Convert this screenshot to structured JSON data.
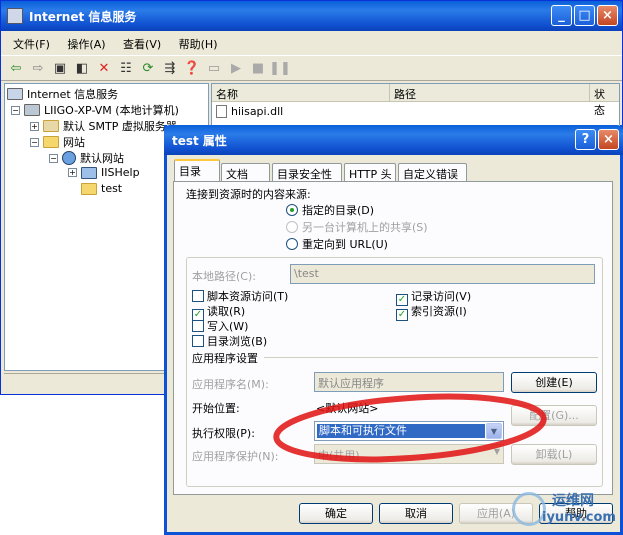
{
  "main_window": {
    "title": "Internet 信息服务",
    "controls": [
      "_",
      "□",
      "×"
    ]
  },
  "menu": [
    "文件(F)",
    "操作(A)",
    "查看(V)",
    "帮助(H)"
  ],
  "tree": {
    "root": "Internet 信息服务",
    "computer": "LIIGO-XP-VM (本地计算机)",
    "smtp": "默认 SMTP 虚拟服务器",
    "websites": "网站",
    "default_site": "默认网站",
    "iishelp": "IISHelp",
    "test": "test"
  },
  "list": {
    "columns": [
      "名称",
      "路径",
      "状态"
    ],
    "rows": [
      "hiisapi.dll"
    ]
  },
  "dialog": {
    "title": "test 属性",
    "help": "?",
    "close": "×",
    "tabs": [
      "目录",
      "文档",
      "目录安全性",
      "HTTP 头",
      "自定义错误"
    ],
    "content_source_label": "连接到资源时的内容来源:",
    "radio_dir": "指定的目录(D)",
    "radio_share": "另一台计算机上的共享(S)",
    "radio_url": "重定向到 URL(U)",
    "local_path_label": "本地路径(C):",
    "local_path_value": "\\test",
    "chk_script": "脚本资源访问(T)",
    "chk_log": "记录访问(V)",
    "chk_read": "读取(R)",
    "chk_index": "索引资源(I)",
    "chk_write": "写入(W)",
    "chk_browse": "目录浏览(B)",
    "app_settings": "应用程序设置",
    "app_name_label": "应用程序名(M):",
    "app_name_value": "默认应用程序",
    "start_label": "开始位置:",
    "start_value": "<默认网站>",
    "exec_label": "执行权限(P):",
    "exec_value": "脚本和可执行文件",
    "protect_label": "应用程序保护(N):",
    "protect_value": "中(共用)",
    "create_btn": "创建(E)",
    "config_btn": "配置(G)...",
    "unload_btn": "卸载(L)",
    "ok": "确定",
    "cancel": "取消",
    "apply": "应用(A)",
    "help_btn": "帮助"
  },
  "watermark": {
    "line1": "运维网",
    "line2": "iyunv.com"
  },
  "colors": {
    "title_blue": "#0b52d6",
    "highlight": "#316ac5",
    "annotation_red": "#e01010"
  }
}
